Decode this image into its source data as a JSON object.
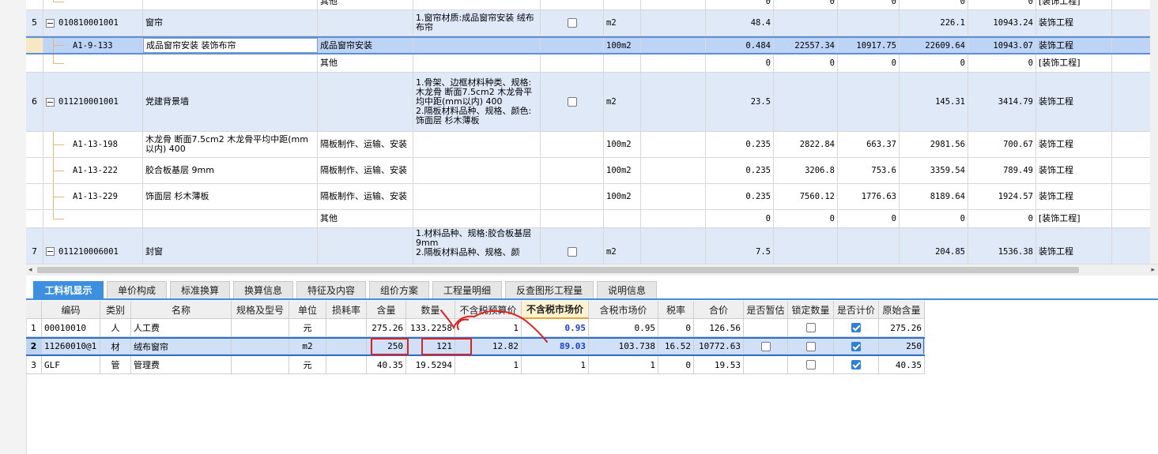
{
  "upper_grid": {
    "rows": [
      {
        "type": "other",
        "tail": true,
        "name_or_cat": "其他",
        "qty": "0",
        "p1": "0",
        "p2": "0",
        "p3": "0",
        "p4": "0",
        "total": "0",
        "category": "[装饰工程]"
      },
      {
        "type": "section",
        "index": "5",
        "code": "010810001001",
        "name": "窗帘",
        "desc": "1.窗帘材质:成品窗帘安装 绒布布帘",
        "unit": "m2",
        "qty": "48.4",
        "p1": "",
        "p2": "",
        "p3": "",
        "p4": "226.1",
        "total": "10943.24",
        "category": "装饰工程"
      },
      {
        "type": "selected",
        "code": "A1-9-133",
        "name": "成品窗帘安装 装饰布帘",
        "cat": "成品窗帘安装",
        "unit": "100m2",
        "qty": "0.484",
        "p1": "22557.34",
        "p2": "10917.75",
        "p3": "22609.64",
        "total": "10943.07",
        "category": "装饰工程"
      },
      {
        "type": "other",
        "name_or_cat": "其他",
        "qty": "0",
        "p1": "0",
        "p2": "0",
        "p3": "0",
        "total": "0",
        "category": "[装饰工程]"
      },
      {
        "type": "section",
        "index": "6",
        "code": "011210001001",
        "name": "党建背景墙",
        "desc": "1.骨架、边框材料种类、规格:木龙骨 断面7.5cm2 木龙骨平均中距(mm以内) 400\n2.隔板材料品种、规格、颜色:饰面层 杉木薄板",
        "unit": "m2",
        "qty": "23.5",
        "p1": "",
        "p2": "",
        "p3": "",
        "p4": "145.31",
        "total": "3414.79",
        "category": "装饰工程"
      },
      {
        "type": "item",
        "code": "A1-13-198",
        "name": "木龙骨 断面7.5cm2 木龙骨平均中距(mm以内) 400",
        "cat": "隔板制作、运输、安装",
        "unit": "100m2",
        "qty": "0.235",
        "p1": "2822.84",
        "p2": "663.37",
        "p3": "2981.56",
        "total": "700.67",
        "category": "装饰工程"
      },
      {
        "type": "item",
        "code": "A1-13-222",
        "name": "胶合板基层 9mm",
        "cat": "隔板制作、运输、安装",
        "unit": "100m2",
        "qty": "0.235",
        "p1": "3206.8",
        "p2": "753.6",
        "p3": "3359.54",
        "total": "789.49",
        "category": "装饰工程"
      },
      {
        "type": "item",
        "code": "A1-13-229",
        "name": "饰面层 杉木薄板",
        "cat": "隔板制作、运输、安装",
        "unit": "100m2",
        "qty": "0.235",
        "p1": "7560.12",
        "p2": "1776.63",
        "p3": "8189.64",
        "total": "1924.57",
        "category": "装饰工程"
      },
      {
        "type": "other",
        "name_or_cat": "其他",
        "qty": "0",
        "p1": "0",
        "p2": "0",
        "p3": "0",
        "total": "0",
        "category": "[装饰工程]"
      },
      {
        "type": "section",
        "index": "7",
        "code": "011210006001",
        "name": "封窗",
        "desc": "1.材料品种、规格:胶合板基层 9mm\n2.隔板材料品种、规格、颜",
        "unit": "m2",
        "qty": "7.5",
        "p1": "",
        "p2": "",
        "p3": "",
        "p4": "204.85",
        "total": "1536.38",
        "category": "装饰工程"
      }
    ]
  },
  "tabs": [
    {
      "label": "工料机显示",
      "active": true
    },
    {
      "label": "单价构成"
    },
    {
      "label": "标准换算"
    },
    {
      "label": "换算信息"
    },
    {
      "label": "特征及内容"
    },
    {
      "label": "组价方案"
    },
    {
      "label": "工程量明细"
    },
    {
      "label": "反查图形工程量"
    },
    {
      "label": "说明信息"
    }
  ],
  "lower_grid": {
    "headers": [
      "编码",
      "类别",
      "名称",
      "规格及型号",
      "单位",
      "损耗率",
      "含量",
      "数量",
      "不含税预算价",
      "不含税市场价",
      "含税市场价",
      "税率",
      "合价",
      "是否暂估",
      "锁定数量",
      "是否计价",
      "原始含量"
    ],
    "rows": [
      {
        "no": "1",
        "code": "00010010",
        "cls": "人",
        "name": "人工费",
        "spec": "",
        "unit": "元",
        "loss": "",
        "content": "275.26",
        "amount": "133.2258",
        "budget": "1",
        "market": "0.95",
        "tax_market": "0.95",
        "tax_rate": "0",
        "total": "126.56",
        "provisional": null,
        "locked": false,
        "priced": true,
        "orig": "275.26"
      },
      {
        "no": "2",
        "code": "11260010@1",
        "cls": "材",
        "name": "绒布窗帘",
        "spec": "",
        "unit": "m2",
        "loss": "",
        "content": "250",
        "amount": "121",
        "budget": "12.82",
        "market": "89.03",
        "tax_market": "103.738",
        "tax_rate": "16.52",
        "total": "10772.63",
        "provisional": false,
        "locked": false,
        "priced": true,
        "orig": "250"
      },
      {
        "no": "3",
        "code": "GLF",
        "cls": "管",
        "name": "管理费",
        "spec": "",
        "unit": "元",
        "loss": "",
        "content": "40.35",
        "amount": "19.5294",
        "budget": "1",
        "market": "1",
        "tax_market": "1",
        "tax_rate": "0",
        "total": "19.53",
        "provisional": null,
        "locked": false,
        "priced": true,
        "orig": "40.35"
      }
    ]
  },
  "colors": {
    "accent": "#3d8fe0",
    "annotation": "#e02020",
    "value_blue": "#1a3fd0"
  }
}
